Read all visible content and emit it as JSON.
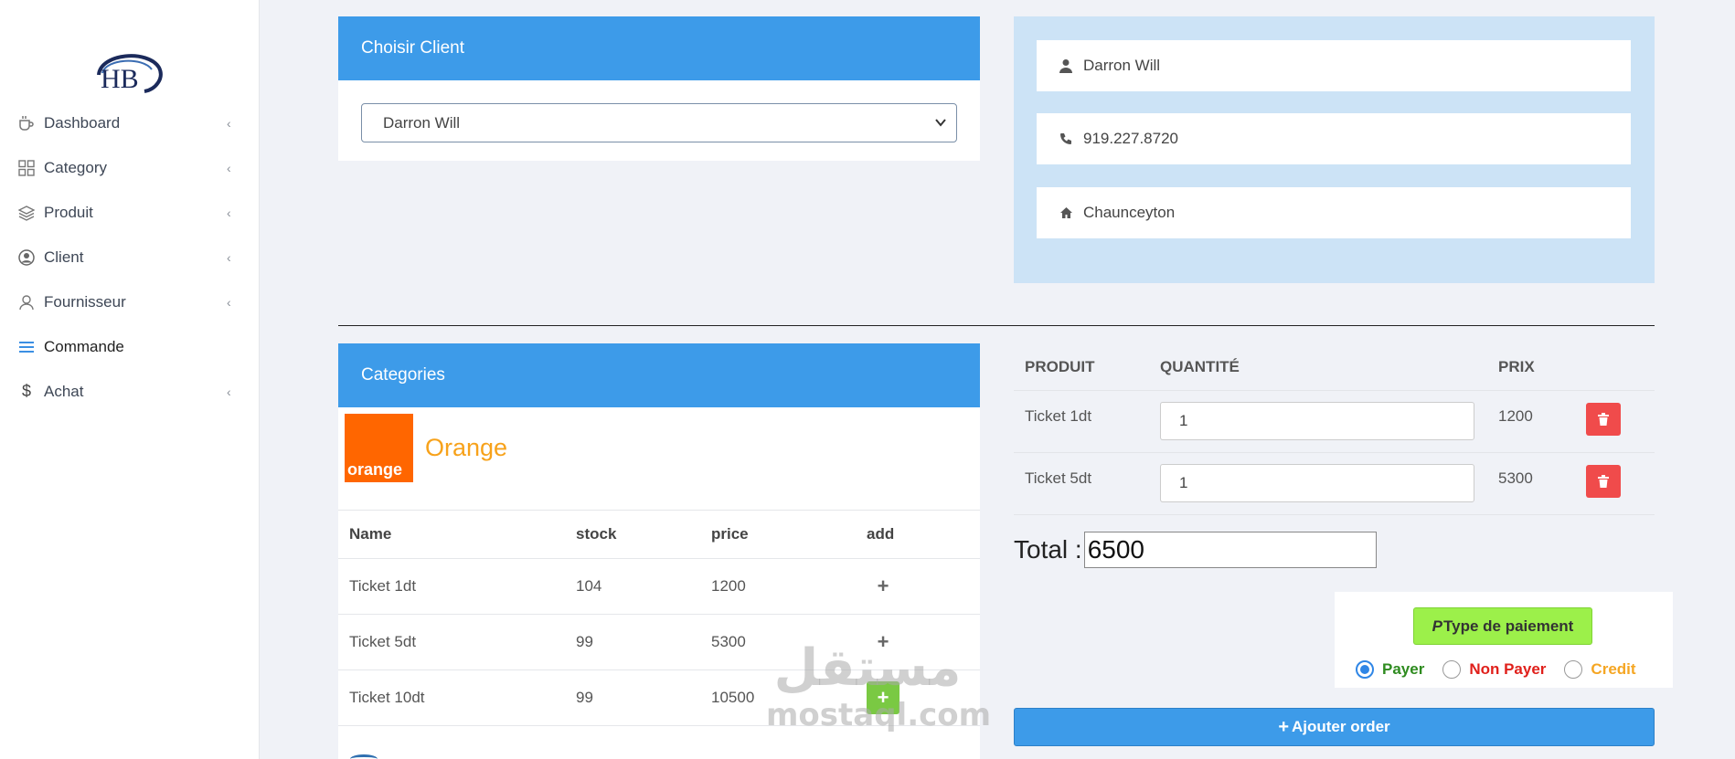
{
  "sidebar": {
    "logo_text": "HB",
    "items": [
      {
        "label": "Dashboard",
        "icon": "coffee-cup-icon"
      },
      {
        "label": "Category",
        "icon": "grid-icon"
      },
      {
        "label": "Produit",
        "icon": "layers-icon"
      },
      {
        "label": "Client",
        "icon": "user-circle-icon"
      },
      {
        "label": "Fournisseur",
        "icon": "user-outline-icon"
      },
      {
        "label": "Commande",
        "icon": "menu-lines-icon",
        "active": true
      },
      {
        "label": "Achat",
        "icon": "dollar-icon"
      }
    ]
  },
  "client_select": {
    "header": "Choisir Client",
    "selected": "Darron Will"
  },
  "client_info": {
    "name": "Darron Will",
    "phone": "919.227.8720",
    "city": "Chaunceyton"
  },
  "categories": {
    "header": "Categories",
    "brand_logo_text": "orange",
    "brand_name": "Orange",
    "columns": [
      "Name",
      "stock",
      "price",
      "add"
    ],
    "rows": [
      {
        "name": "Ticket 1dt",
        "stock": "104",
        "price": "1200"
      },
      {
        "name": "Ticket 5dt",
        "stock": "99",
        "price": "5300"
      },
      {
        "name": "Ticket 10dt",
        "stock": "99",
        "price": "10500"
      }
    ]
  },
  "order": {
    "columns": [
      "PRODUIT",
      "QUANTITÉ",
      "PRIX"
    ],
    "rows": [
      {
        "product": "Ticket 1dt",
        "qty": "1",
        "price": "1200"
      },
      {
        "product": "Ticket 5dt",
        "qty": "1",
        "price": "5300"
      }
    ],
    "total_label": "Total :",
    "total_value": "6500"
  },
  "payment": {
    "button_label": "Type de paiement",
    "options": [
      {
        "label": "Payer",
        "color": "#2e8b1f",
        "selected": true
      },
      {
        "label": "Non Payer",
        "color": "#e0201b",
        "selected": false
      },
      {
        "label": "Credit",
        "color": "#f5a623",
        "selected": false
      }
    ]
  },
  "add_order_label": "Ajouter order",
  "watermark": {
    "arabic": "مستقل",
    "latin": "mostaql.com"
  },
  "colors": {
    "primary": "#3d9be9",
    "danger": "#f04b4b",
    "success_light": "#9cf04a",
    "orange_brand": "#ff6600"
  }
}
